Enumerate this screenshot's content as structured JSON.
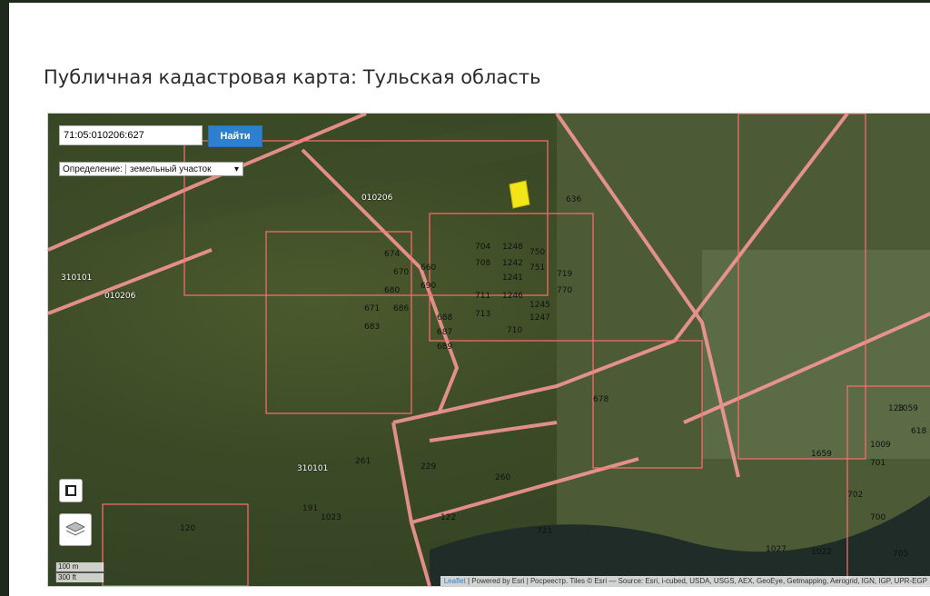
{
  "page": {
    "title": "Публичная кадастровая карта: Тульская область"
  },
  "search": {
    "value": "71:05:010206:627",
    "button_label": "Найти"
  },
  "definition": {
    "label": "Определение:",
    "value": "земельный участок"
  },
  "zones": [
    "010206",
    "310101",
    "010206",
    "310101"
  ],
  "plot_numbers": [
    "704",
    "1248",
    "750",
    "708",
    "1242",
    "751",
    "719",
    "1241",
    "1246",
    "770",
    "1245",
    "1247",
    "710",
    "713",
    "711",
    "688",
    "687",
    "689",
    "674",
    "670",
    "680",
    "660",
    "690",
    "671",
    "683",
    "686",
    "678",
    "1659",
    "1059",
    "1009",
    "701",
    "702",
    "700",
    "705",
    "1022",
    "1027",
    "1023",
    "122",
    "721",
    "260",
    "229",
    "261",
    "191",
    "120",
    "123",
    "618",
    "636"
  ],
  "scale": {
    "metric": "100 m",
    "imperial": "300 ft"
  },
  "attribution": {
    "leaflet": "Leaflet",
    "text": " | Powered by Esri | Росреестр. Tiles © Esri — Source: Esri, i-cubed, USDA, USGS, AEX, GeoEye, Getmapping, Aerogrid, IGN, IGP, UPR-EGP"
  },
  "colors": {
    "parcel": "#ff8a8a",
    "selected": "#f2e61a",
    "button": "#2f7fd1"
  }
}
